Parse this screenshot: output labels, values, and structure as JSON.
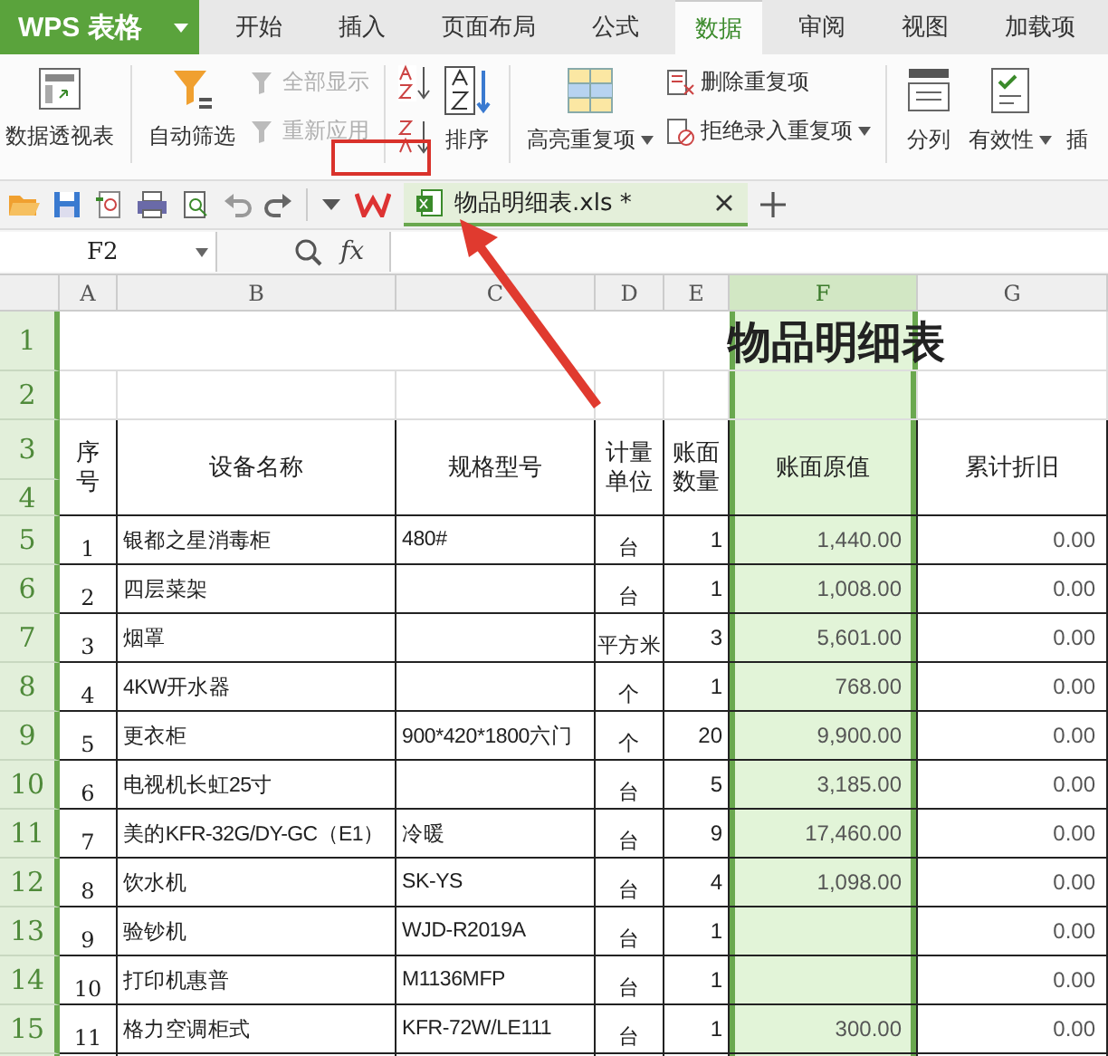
{
  "app_menu": {
    "label": "WPS 表格"
  },
  "tabs": [
    {
      "label": "开始",
      "selected": false
    },
    {
      "label": "插入",
      "selected": false
    },
    {
      "label": "页面布局",
      "selected": false
    },
    {
      "label": "公式",
      "selected": false
    },
    {
      "label": "数据",
      "selected": true
    },
    {
      "label": "审阅",
      "selected": false
    },
    {
      "label": "视图",
      "selected": false
    },
    {
      "label": "加载项",
      "selected": false
    }
  ],
  "ribbon": {
    "pivot": {
      "label": "数据透视表"
    },
    "filter": {
      "label": "自动筛选"
    },
    "show_all": {
      "label": "全部显示",
      "disabled": true
    },
    "reapply": {
      "label": "重新应用",
      "disabled": true
    },
    "sort": {
      "label": "排序"
    },
    "highlight_dup": {
      "label": "高亮重复项"
    },
    "remove_dup": {
      "label": "删除重复项"
    },
    "reject_dup": {
      "label": "拒绝录入重复项"
    },
    "split": {
      "label": "分列"
    },
    "validation": {
      "label": "有效性"
    },
    "insert_cut": {
      "label": "插"
    }
  },
  "document_tab": {
    "title": "物品明细表.xls *"
  },
  "formula_bar": {
    "name_box": "F2",
    "function_label": "fx"
  },
  "sheet": {
    "columns": [
      {
        "label": "A",
        "selected": false
      },
      {
        "label": "B",
        "selected": false
      },
      {
        "label": "C",
        "selected": false
      },
      {
        "label": "D",
        "selected": false
      },
      {
        "label": "E",
        "selected": false
      },
      {
        "label": "F",
        "selected": true
      },
      {
        "label": "G",
        "selected": false
      }
    ],
    "row_numbers": [
      "1",
      "2",
      "3",
      "4",
      "5",
      "6",
      "7",
      "8",
      "9",
      "10",
      "11",
      "12",
      "13",
      "14",
      "15"
    ],
    "title": "物品明细表",
    "headers": [
      "序号",
      "设备名称",
      "规格型号",
      "计量单位",
      "账面数量",
      "账面原值",
      "累计折旧"
    ],
    "rows": [
      {
        "seq": "1",
        "name": "银都之星消毒柜",
        "spec": "480#",
        "unit": "台",
        "qty": "1",
        "value": "1,440.00",
        "depreciation": "0.00"
      },
      {
        "seq": "2",
        "name": "四层菜架",
        "unit": "台",
        "qty": "1",
        "value": "1,008.00",
        "depreciation": "0.00"
      },
      {
        "seq": "3",
        "name": "烟罩",
        "unit": "平方米",
        "qty": "3",
        "value": "5,601.00",
        "depreciation": "0.00"
      },
      {
        "seq": "4",
        "name": "4KW开水器",
        "unit": "个",
        "qty": "1",
        "value": "768.00",
        "depreciation": "0.00"
      },
      {
        "seq": "5",
        "name": "更衣柜",
        "spec": "900*420*1800六门",
        "unit": "个",
        "qty": "20",
        "value": "9,900.00",
        "depreciation": "0.00"
      },
      {
        "seq": "6",
        "name": "电视机长虹25寸",
        "unit": "台",
        "qty": "5",
        "value": "3,185.00",
        "depreciation": "0.00"
      },
      {
        "seq": "7",
        "name": "美的KFR-32G/DY-GC（E1）",
        "spec": "冷暖",
        "unit": "台",
        "qty": "9",
        "value": "17,460.00",
        "depreciation": "0.00"
      },
      {
        "seq": "8",
        "name": "饮水机",
        "spec": "SK-YS",
        "unit": "台",
        "qty": "4",
        "value": "1,098.00",
        "depreciation": "0.00"
      },
      {
        "seq": "9",
        "name": "验钞机",
        "spec": "WJD-R2019A",
        "unit": "台",
        "qty": "1",
        "depreciation": "0.00"
      },
      {
        "seq": "10",
        "name": "打印机惠普",
        "spec": "M1136MFP",
        "unit": "台",
        "qty": "1",
        "depreciation": "0.00"
      },
      {
        "seq": "11",
        "name": "格力空调柜式",
        "spec": "KFR-72W/LE111",
        "unit": "台",
        "qty": "1",
        "value": "300.00",
        "depreciation": "0.00"
      }
    ]
  }
}
